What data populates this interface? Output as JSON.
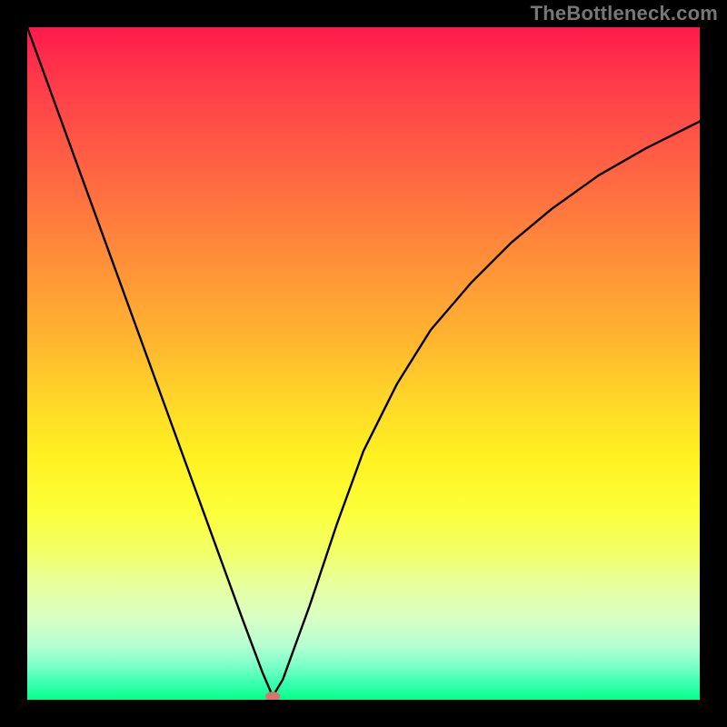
{
  "watermark": "TheBottleneck.com",
  "chart_data": {
    "type": "line",
    "title": "",
    "xlabel": "",
    "ylabel": "",
    "xlim": [
      0,
      100
    ],
    "ylim": [
      0,
      100
    ],
    "grid": false,
    "legend": false,
    "series": [
      {
        "name": "curve",
        "x": [
          0,
          4,
          8,
          12,
          16,
          20,
          24,
          28,
          32,
          35,
          36.5,
          38,
          42,
          46,
          50,
          55,
          60,
          66,
          72,
          78,
          85,
          92,
          100
        ],
        "y": [
          100,
          89,
          78,
          67,
          56,
          45,
          34,
          23,
          12,
          4,
          0.5,
          3,
          14,
          26,
          37,
          47,
          55,
          62,
          68,
          73,
          78,
          82,
          86
        ],
        "color": "#000000"
      }
    ],
    "marker": {
      "x": 36.5,
      "y": 0.5,
      "rx": 1.1,
      "ry": 0.7,
      "color": "#d7766f"
    },
    "gradient_stops": [
      {
        "pos": 0,
        "color": "#ff1a4d"
      },
      {
        "pos": 50,
        "color": "#ffd928"
      },
      {
        "pos": 100,
        "color": "#05ff8a"
      }
    ]
  }
}
